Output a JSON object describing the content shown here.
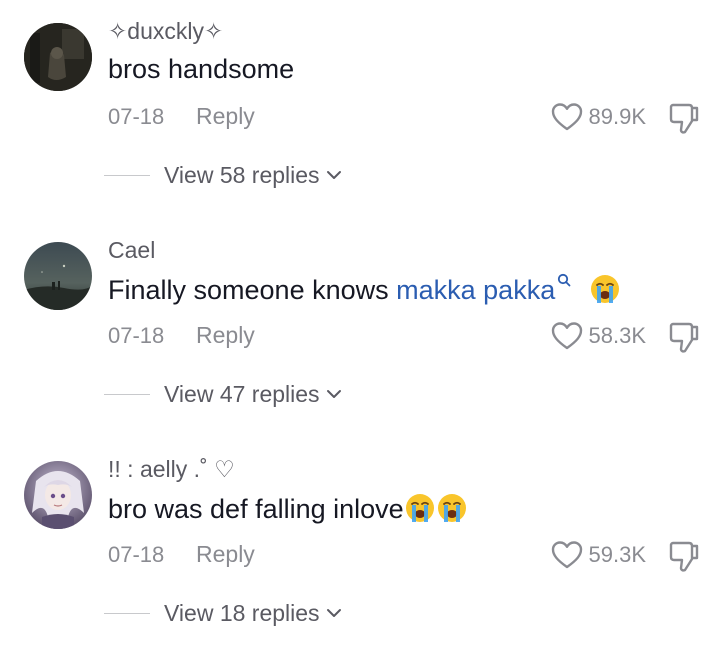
{
  "comments": [
    {
      "username": "✧duxckly✧",
      "text": "bros handsome",
      "date": "07-18",
      "reply_label": "Reply",
      "likes": "89.9K",
      "view_replies": "View 58 replies"
    },
    {
      "username": "Cael",
      "text": "Finally someone knows ",
      "mention": "makka pakka",
      "date": "07-18",
      "reply_label": "Reply",
      "likes": "58.3K",
      "view_replies": "View 47 replies"
    },
    {
      "username": "!! : aelly .˚ ♡",
      "text": "bro was def falling inlove",
      "date": "07-18",
      "reply_label": "Reply",
      "likes": "59.3K",
      "view_replies": "View 18 replies"
    }
  ],
  "icons": {
    "like": "heart-icon",
    "dislike": "thumbs-down-icon",
    "expand": "chevron-down-icon",
    "emoji": "loudly-crying-face-emoji",
    "search": "search-icon"
  },
  "colors": {
    "text": "#161823",
    "secondary": "#8a8b91",
    "username": "#5a5a62",
    "mention": "#2b5db1"
  }
}
